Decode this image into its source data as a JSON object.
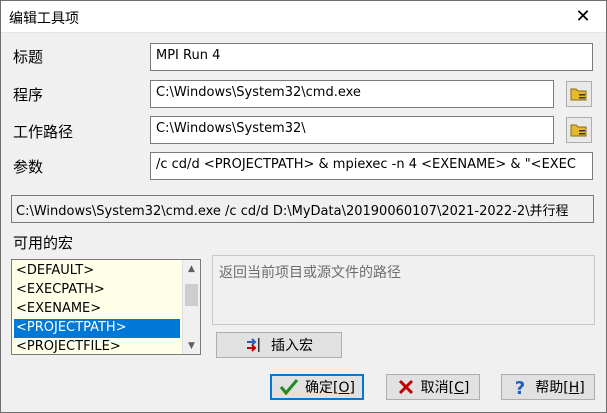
{
  "window": {
    "title": "编辑工具项",
    "close_glyph": "✕"
  },
  "form": {
    "title_label": "标题",
    "title_value": "MPI Run 4",
    "program_label": "程序",
    "program_value": "C:\\Windows\\System32\\cmd.exe",
    "workdir_label": "工作路径",
    "workdir_value": "C:\\Windows\\System32\\",
    "args_label": "参数",
    "args_value": "/c cd/d  <PROJECTPATH> & mpiexec -n 4 <EXENAME> & \"<EXEC"
  },
  "preview": {
    "command": "C:\\Windows\\System32\\cmd.exe /c cd/d  D:\\MyData\\20190060107\\2021-2022-2\\并行程"
  },
  "macros": {
    "label": "可用的宏",
    "items": [
      "<DEFAULT>",
      "<EXECPATH>",
      "<EXENAME>",
      "<PROJECTPATH>",
      "<PROJECTFILE>"
    ],
    "selected_index": 3,
    "description": "返回当前项目或源文件的路径",
    "insert_label": "插入宏"
  },
  "buttons": {
    "ok_text": "确定[",
    "ok_key": "O",
    "ok_end": "]",
    "cancel_text": "取消[",
    "cancel_key": "C",
    "cancel_end": "]",
    "help_text": "帮助[",
    "help_key": "H",
    "help_end": "]"
  },
  "icons": {
    "browse": "folder-browse-icon",
    "insert": "insert-macro-icon",
    "ok": "checkmark-icon",
    "cancel": "x-icon",
    "help": "question-icon"
  },
  "colors": {
    "selection": "#0078d7",
    "list_bg": "#ffffe8",
    "ok_check": "#1e8c1e",
    "cancel_x": "#c00000",
    "help_q": "#1f5fbf"
  }
}
